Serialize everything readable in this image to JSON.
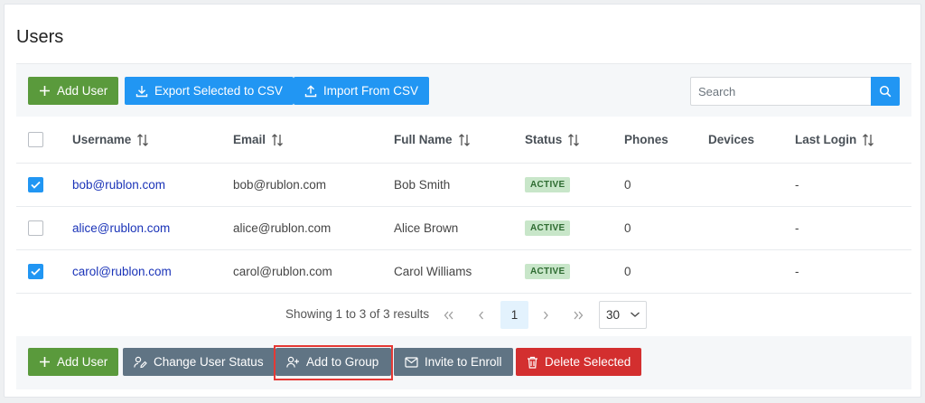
{
  "page": {
    "title": "Users"
  },
  "toolbar": {
    "add_user": "Add User",
    "export": "Export Selected to CSV",
    "import": "Import From CSV",
    "search_placeholder": "Search"
  },
  "table": {
    "columns": [
      "Username",
      "Email",
      "Full Name",
      "Status",
      "Phones",
      "Devices",
      "Last Login"
    ],
    "rows": [
      {
        "checked": true,
        "username": "bob@rublon.com",
        "email": "bob@rublon.com",
        "full_name": "Bob Smith",
        "status": "ACTIVE",
        "phones": "0",
        "devices": "",
        "last_login": "-"
      },
      {
        "checked": false,
        "username": "alice@rublon.com",
        "email": "alice@rublon.com",
        "full_name": "Alice Brown",
        "status": "ACTIVE",
        "phones": "0",
        "devices": "",
        "last_login": "-"
      },
      {
        "checked": true,
        "username": "carol@rublon.com",
        "email": "carol@rublon.com",
        "full_name": "Carol Williams",
        "status": "ACTIVE",
        "phones": "0",
        "devices": "",
        "last_login": "-"
      }
    ]
  },
  "pagination": {
    "summary": "Showing 1 to 3 of 3 results",
    "current_page": "1",
    "page_size": "30"
  },
  "bulk_actions": {
    "add_user": "Add User",
    "change_status": "Change User Status",
    "add_to_group": "Add to Group",
    "invite": "Invite to Enroll",
    "delete": "Delete Selected"
  },
  "colors": {
    "green": "#5a9a3c",
    "blue": "#2196f3",
    "grey": "#607484",
    "red": "#d32f2f",
    "badge_bg": "#c8e6c9",
    "link": "#1a33b8"
  }
}
